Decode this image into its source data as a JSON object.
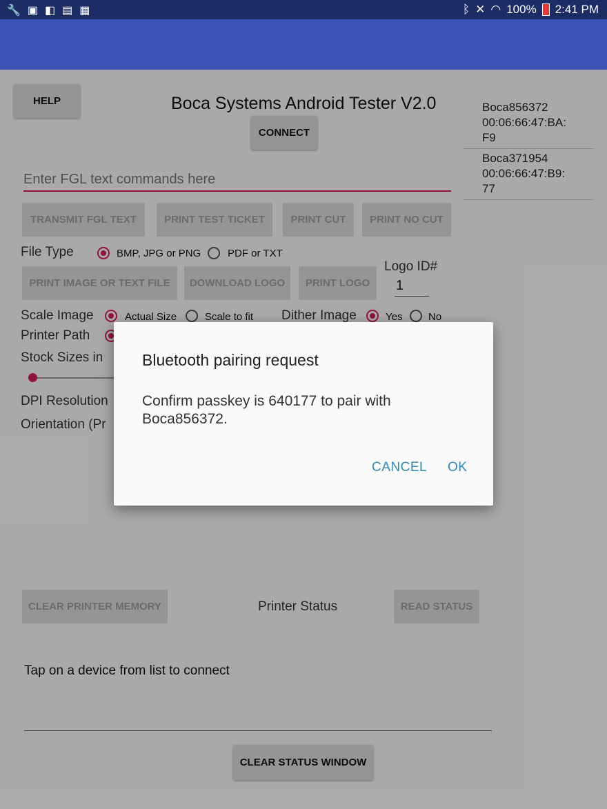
{
  "status_bar": {
    "battery": "100%",
    "time": "2:41 PM",
    "icons": [
      "wrench-icon",
      "photo-icon",
      "flipboard-icon",
      "store-icon",
      "briefcase-icon",
      "bluetooth-icon",
      "mute-icon",
      "wifi-icon",
      "battery-icon"
    ]
  },
  "colors": {
    "appbar": "#3f51b5",
    "statusbar": "#1c2d66",
    "accent": "#d81b60",
    "dialog_button": "#2e8cb6"
  },
  "app": {
    "title": "Boca Systems Android Tester V2.0",
    "help_button": "HELP",
    "connect_button": "CONNECT",
    "fgl_input_placeholder": "Enter FGL text commands here",
    "action_buttons": [
      "TRANSMIT FGL TEXT",
      "PRINT TEST TICKET",
      "PRINT CUT",
      "PRINT NO CUT"
    ],
    "file_type": {
      "label": "File Type",
      "options": [
        "BMP, JPG or PNG",
        "PDF or TXT"
      ],
      "selected": "BMP, JPG or PNG"
    },
    "file_buttons": [
      "PRINT IMAGE OR TEXT FILE",
      "DOWNLOAD LOGO",
      "PRINT LOGO"
    ],
    "logo_id": {
      "label": "Logo ID#",
      "value": "1"
    },
    "scale_image": {
      "label": "Scale Image",
      "options": [
        "Actual Size",
        "Scale to fit"
      ],
      "selected": "Actual Size"
    },
    "dither_image": {
      "label": "Dither Image",
      "options": [
        "Yes",
        "No"
      ],
      "selected": "Yes"
    },
    "printer_path_label": "Printer Path",
    "stock_sizes_label": "Stock Sizes in",
    "dpi_label": "DPI Resolution",
    "orientation_label": "Orientation (Pr",
    "clear_memory_button": "CLEAR PRINTER MEMORY",
    "printer_status_label": "Printer Status",
    "read_status_button": "READ STATUS",
    "status_message": "Tap on a device from list to connect",
    "clear_status_button": "CLEAR STATUS WINDOW",
    "devices": [
      {
        "name": "Boca856372",
        "mac": "00:06:66:47:BA:",
        "mac2": "F9"
      },
      {
        "name": "Boca371954",
        "mac": "00:06:66:47:B9:",
        "mac2": "77"
      }
    ]
  },
  "dialog": {
    "title": "Bluetooth pairing request",
    "message": "Confirm passkey is 640177 to pair with Boca856372.",
    "cancel": "CANCEL",
    "ok": "OK"
  }
}
